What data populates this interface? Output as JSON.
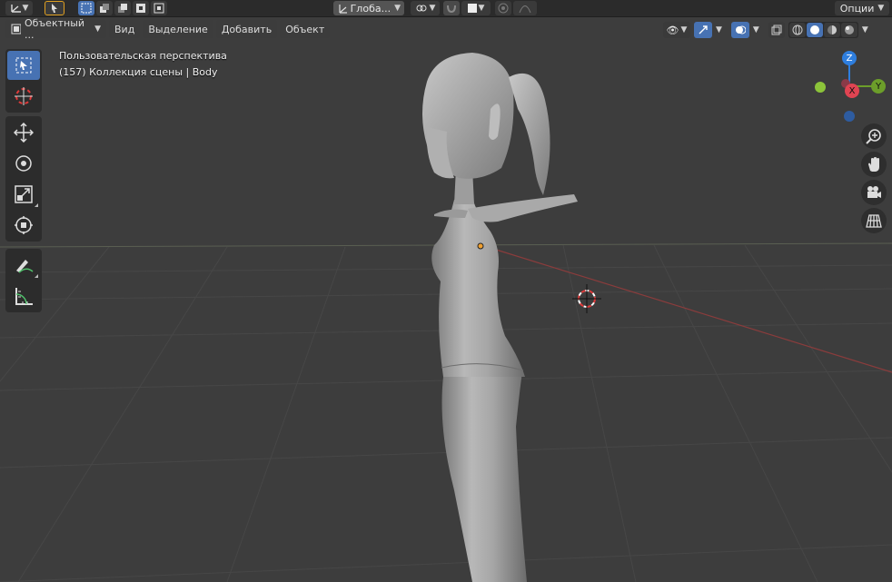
{
  "topbar": {
    "transform_orientation": "Глоба...",
    "options_label": "Опции"
  },
  "header": {
    "mode_label": "Объектный ...",
    "menus": [
      "Вид",
      "Выделение",
      "Добавить",
      "Объект"
    ]
  },
  "viewport": {
    "view_name": "Пользовательская перспектива",
    "collection_info": "(157) Коллекция сцены | Body"
  },
  "gizmo": {
    "z_label": "Z",
    "y_label": "Y",
    "x_label": "X",
    "colors": {
      "x": "#e04452",
      "y": "#6c9e2a",
      "z": "#2e7ede"
    }
  },
  "theme": {
    "background": "#3d3d3d",
    "accent": "#4772b3"
  },
  "icons": {
    "toolbar": [
      "select-box-icon",
      "cursor-icon",
      "move-icon",
      "rotate-icon",
      "scale-icon",
      "transform-icon",
      "annotate-icon",
      "measure-icon"
    ],
    "nav": [
      "zoom-icon",
      "pan-hand-icon",
      "camera-icon",
      "grid-ortho-icon"
    ]
  }
}
